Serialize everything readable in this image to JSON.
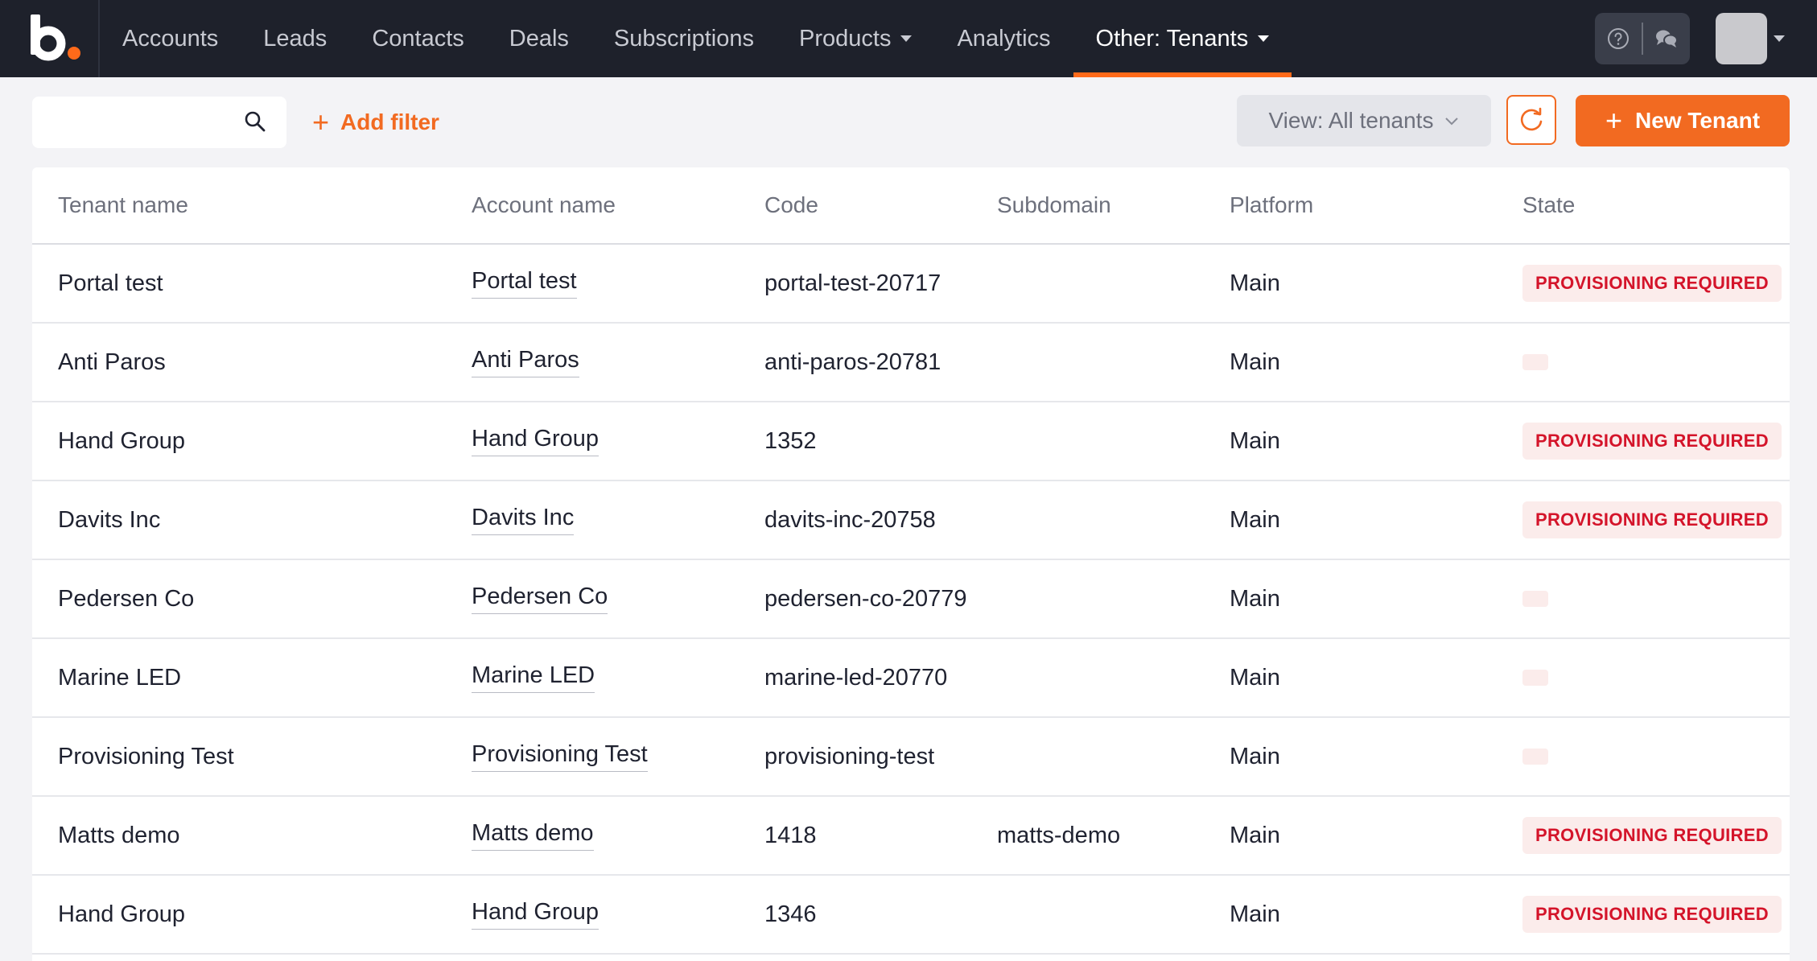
{
  "nav": {
    "items": [
      {
        "label": "Accounts"
      },
      {
        "label": "Leads"
      },
      {
        "label": "Contacts"
      },
      {
        "label": "Deals"
      },
      {
        "label": "Subscriptions"
      },
      {
        "label": "Products",
        "dropdown": true
      },
      {
        "label": "Analytics"
      },
      {
        "label": "Other: Tenants",
        "dropdown": true,
        "active": true
      }
    ],
    "icons": [
      "help-icon",
      "chat-icon"
    ],
    "accent_color": "#ff6a1a"
  },
  "toolbar": {
    "search_value": "",
    "add_filter_label": "Add filter",
    "view_label": "View: All tenants",
    "new_button_label": "New Tenant"
  },
  "table": {
    "columns": [
      "Tenant name",
      "Account name",
      "Code",
      "Subdomain",
      "Platform",
      "State"
    ],
    "rows": [
      {
        "tenant": "Portal test",
        "account": "Portal test",
        "code": "portal-test-20717",
        "subdomain": "",
        "platform": "Main",
        "state": "PROVISIONING REQUIRED"
      },
      {
        "tenant": "Anti Paros",
        "account": "Anti Paros",
        "code": "anti-paros-20781",
        "subdomain": "",
        "platform": "Main",
        "state": ""
      },
      {
        "tenant": "Hand Group",
        "account": "Hand Group",
        "code": "1352",
        "subdomain": "",
        "platform": "Main",
        "state": "PROVISIONING REQUIRED"
      },
      {
        "tenant": "Davits Inc",
        "account": "Davits Inc",
        "code": "davits-inc-20758",
        "subdomain": "",
        "platform": "Main",
        "state": "PROVISIONING REQUIRED"
      },
      {
        "tenant": "Pedersen Co",
        "account": "Pedersen Co",
        "code": "pedersen-co-20779",
        "subdomain": "",
        "platform": "Main",
        "state": ""
      },
      {
        "tenant": "Marine LED",
        "account": "Marine LED",
        "code": "marine-led-20770",
        "subdomain": "",
        "platform": "Main",
        "state": ""
      },
      {
        "tenant": "Provisioning Test",
        "account": "Provisioning Test",
        "code": "provisioning-test",
        "subdomain": "",
        "platform": "Main",
        "state": ""
      },
      {
        "tenant": "Matts demo",
        "account": "Matts demo",
        "code": "1418",
        "subdomain": "matts-demo",
        "platform": "Main",
        "state": "PROVISIONING REQUIRED"
      },
      {
        "tenant": "Hand Group",
        "account": "Hand Group",
        "code": "1346",
        "subdomain": "",
        "platform": "Main",
        "state": "PROVISIONING REQUIRED"
      }
    ],
    "state_badge_color": "#d4142a"
  }
}
